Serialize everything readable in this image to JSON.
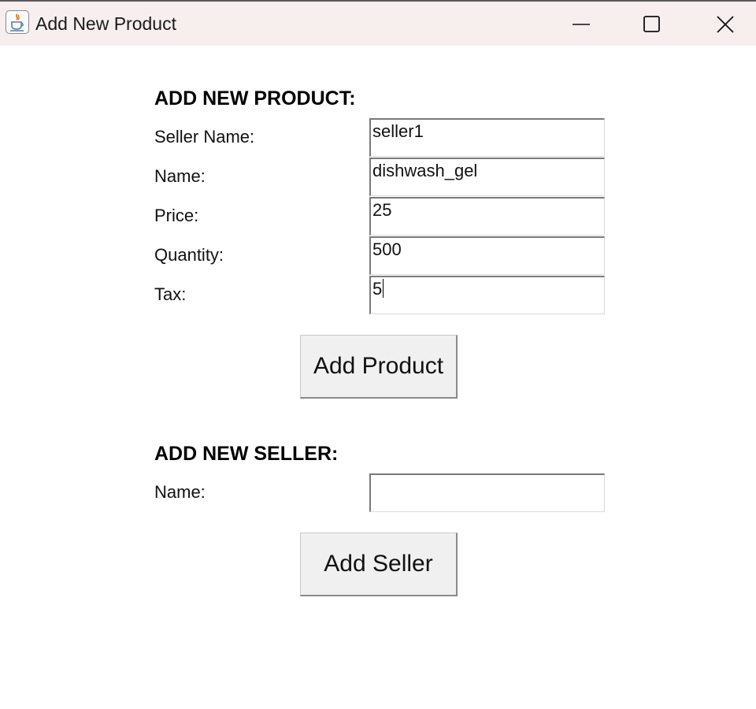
{
  "window": {
    "title": "Add New Product",
    "app_icon": "java-cup-icon",
    "controls": [
      "minimize-icon",
      "maximize-icon",
      "close-icon"
    ]
  },
  "product_section": {
    "heading": "ADD NEW PRODUCT:",
    "fields": [
      {
        "label": "Seller Name:",
        "value": "seller1"
      },
      {
        "label": "Name:",
        "value": "dishwash_gel"
      },
      {
        "label": "Price:",
        "value": "25"
      },
      {
        "label": "Quantity:",
        "value": "500"
      },
      {
        "label": "Tax:",
        "value": "5"
      }
    ],
    "button_label": "Add Product"
  },
  "seller_section": {
    "heading": "ADD NEW SELLER:",
    "fields": [
      {
        "label": "Name:",
        "value": ""
      }
    ],
    "button_label": "Add Seller"
  },
  "colors": {
    "titlebar_bg": "#f7eeee",
    "button_bg": "#f0f0f0",
    "java_orange": "#e76f00",
    "java_blue": "#5382a1"
  }
}
